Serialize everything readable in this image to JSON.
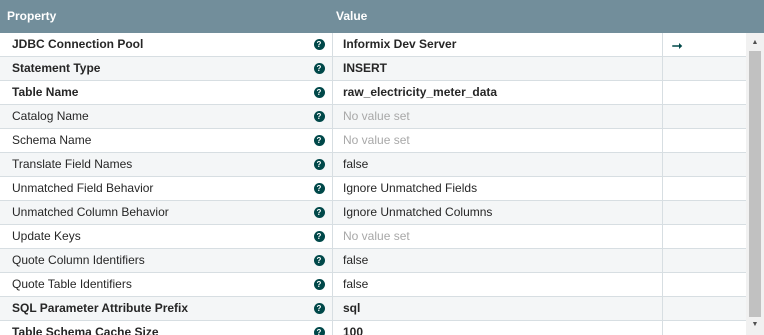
{
  "header": {
    "property_label": "Property",
    "value_label": "Value"
  },
  "rows": [
    {
      "name": "JDBC Connection Pool",
      "value": "Informix Dev Server",
      "bold": true,
      "unset": false,
      "action": "goto"
    },
    {
      "name": "Statement Type",
      "value": "INSERT",
      "bold": true,
      "unset": false
    },
    {
      "name": "Table Name",
      "value": "raw_electricity_meter_data",
      "bold": true,
      "unset": false
    },
    {
      "name": "Catalog Name",
      "value": "No value set",
      "bold": false,
      "unset": true
    },
    {
      "name": "Schema Name",
      "value": "No value set",
      "bold": false,
      "unset": true
    },
    {
      "name": "Translate Field Names",
      "value": "false",
      "bold": false,
      "unset": false
    },
    {
      "name": "Unmatched Field Behavior",
      "value": "Ignore Unmatched Fields",
      "bold": false,
      "unset": false
    },
    {
      "name": "Unmatched Column Behavior",
      "value": "Ignore Unmatched Columns",
      "bold": false,
      "unset": false
    },
    {
      "name": "Update Keys",
      "value": "No value set",
      "bold": false,
      "unset": true
    },
    {
      "name": "Quote Column Identifiers",
      "value": "false",
      "bold": false,
      "unset": false
    },
    {
      "name": "Quote Table Identifiers",
      "value": "false",
      "bold": false,
      "unset": false
    },
    {
      "name": "SQL Parameter Attribute Prefix",
      "value": "sql",
      "bold": true,
      "unset": false
    },
    {
      "name": "Table Schema Cache Size",
      "value": "100",
      "bold": true,
      "unset": false
    }
  ],
  "help_glyph": "?",
  "goto_glyph": "⭢",
  "scroll": {
    "up_glyph": "▲",
    "down_glyph": "▼"
  },
  "colors": {
    "header": "#728e9b",
    "help_icon": "#004849",
    "unset_text": "#a8a8a8"
  },
  "icons": {
    "help": "help-circle-icon",
    "goto": "arrow-right-icon"
  }
}
